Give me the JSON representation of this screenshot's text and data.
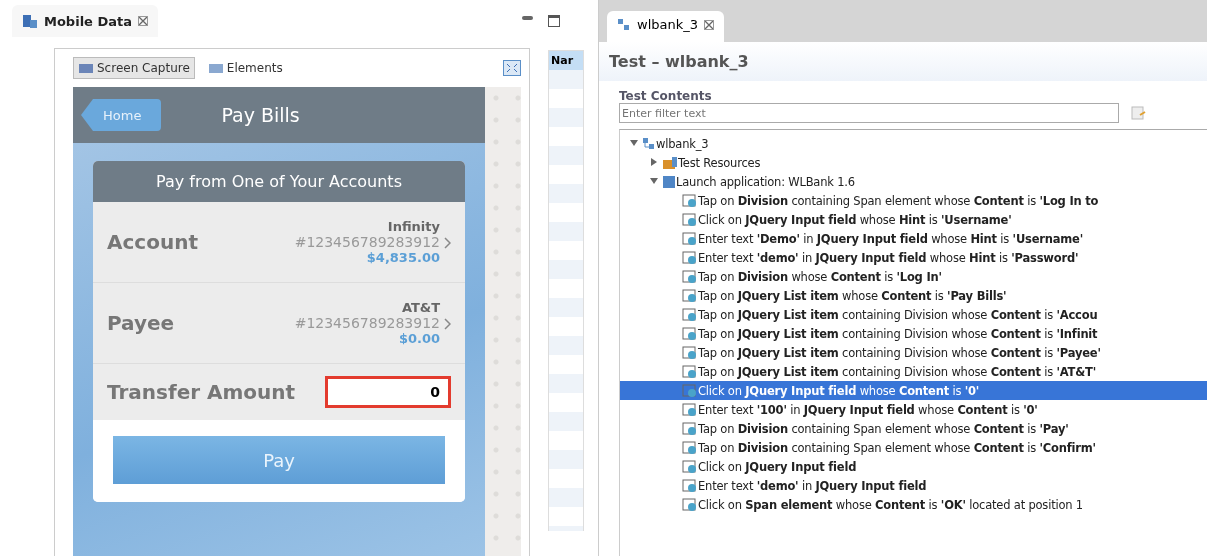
{
  "left_view": {
    "tab": {
      "title": "Mobile Data"
    },
    "subtabs": [
      {
        "label": "Screen Capture",
        "selected": true
      },
      {
        "label": "Elements",
        "selected": false
      }
    ],
    "phone": {
      "back_button": "Home",
      "title": "Pay Bills",
      "card_title": "Pay from One of Your Accounts",
      "rows": [
        {
          "label": "Account",
          "name": "Infinity",
          "number": "#123456789283912",
          "amount": "$4,835.00"
        },
        {
          "label": "Payee",
          "name": "AT&T",
          "number": "#123456789283912",
          "amount": "$0.00"
        }
      ],
      "transfer": {
        "label": "Transfer Amount",
        "value": "0",
        "highlighted": true
      },
      "pay_button": "Pay"
    }
  },
  "middle_view": {
    "column": "Nar"
  },
  "right_view": {
    "tab": {
      "title": "wlbank_3"
    },
    "title": "Test – wlbank_3",
    "section": "Test Contents",
    "filter": {
      "placeholder": "Enter filter text"
    },
    "tree": [
      {
        "label": "wlbank_3",
        "kind": "test",
        "expanded": true,
        "children": [
          {
            "label": "Test Resources",
            "kind": "resources",
            "expanded": false
          },
          {
            "label": "Launch application: WLBank  1.6",
            "kind": "launch",
            "expanded": true,
            "children": [
              {
                "label": "Tap on **Division** containing Span element whose **Content** is **'Log In to**",
                "kind": "step",
                "selected": false
              },
              {
                "label": "Click on **JQuery Input field** whose **Hint** is **'Username'**",
                "kind": "step",
                "selected": false
              },
              {
                "label": "Enter text **'Demo'** in **JQuery Input field** whose **Hint** is **'Username'**",
                "kind": "step",
                "selected": false
              },
              {
                "label": "Enter text **'demo'** in **JQuery Input field** whose **Hint** is **'Password'**",
                "kind": "step",
                "selected": false
              },
              {
                "label": "Tap on **Division** whose **Content** is **'Log In'**",
                "kind": "step",
                "selected": false
              },
              {
                "label": "Tap on **JQuery List item** whose **Content** is **'Pay Bills'**",
                "kind": "step",
                "selected": false
              },
              {
                "label": "Tap on **JQuery List item** containing Division whose **Content** is **'Accou**",
                "kind": "step",
                "selected": false
              },
              {
                "label": "Tap on **JQuery List item** containing Division whose **Content** is **'Infinit**",
                "kind": "step",
                "selected": false
              },
              {
                "label": "Tap on **JQuery List item** containing Division whose **Content** is **'Payee'**",
                "kind": "step",
                "selected": false
              },
              {
                "label": "Tap on **JQuery List item** containing Division whose **Content** is **'AT&T'**",
                "kind": "step",
                "selected": false
              },
              {
                "label": "Click on **JQuery Input field** whose **Content** is **'0'**",
                "kind": "step",
                "selected": true
              },
              {
                "label": "Enter text **'100'** in **JQuery Input field** whose **Content** is **'0'**",
                "kind": "step",
                "selected": false
              },
              {
                "label": "Tap on **Division** containing Span element whose **Content** is **'Pay'**",
                "kind": "step",
                "selected": false
              },
              {
                "label": "Tap on **Division** containing Span element whose **Content** is **'Confirm'**",
                "kind": "step",
                "selected": false
              },
              {
                "label": "Click on **JQuery Input field**",
                "kind": "step",
                "selected": false
              },
              {
                "label": "Enter text **'demo'** in **JQuery Input field**",
                "kind": "step",
                "selected": false
              },
              {
                "label": "Click on **Span element** whose **Content** is **'OK'** located at position 1",
                "kind": "step",
                "selected": false
              }
            ]
          }
        ]
      }
    ]
  }
}
